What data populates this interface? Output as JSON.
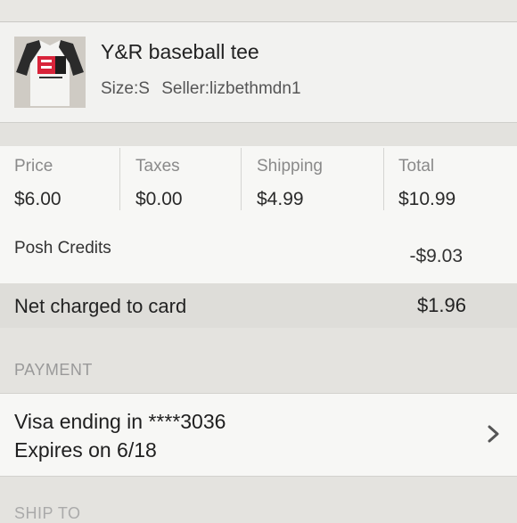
{
  "product": {
    "title": "Y&R baseball tee",
    "size": "Size:S",
    "seller": "Seller:lizbethmdn1",
    "thumbnail_icon": "tee-shirt-photo"
  },
  "summary": {
    "columns": [
      {
        "label": "Price",
        "value": "$6.00"
      },
      {
        "label": "Taxes",
        "value": "$0.00"
      },
      {
        "label": "Shipping",
        "value": "$4.99"
      },
      {
        "label": "Total",
        "value": "$10.99"
      }
    ],
    "posh_credits_label": "Posh Credits",
    "posh_credits_value": "-$9.03",
    "net_label": "Net charged to card",
    "net_value": "$1.96"
  },
  "payment": {
    "header": "PAYMENT",
    "line1": "Visa ending in ****3036",
    "line2": "Expires on 6/18",
    "chevron_icon": "chevron-right-icon"
  },
  "ship_to": {
    "header": "SHIP TO"
  },
  "colors": {
    "background": "#e4e3df",
    "card": "#f7f7f5",
    "muted_text": "#8a8a8a"
  }
}
